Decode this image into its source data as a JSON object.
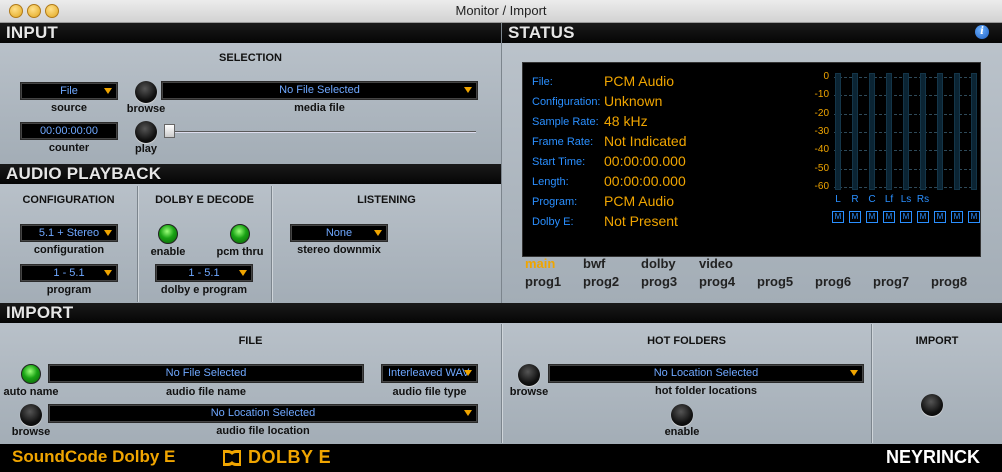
{
  "window": {
    "title": "Monitor / Import"
  },
  "input": {
    "header": "INPUT",
    "selection_label": "SELECTION",
    "source": {
      "value": "File",
      "label": "source"
    },
    "browse_label": "browse",
    "media_file": {
      "value": "No File Selected",
      "label": "media file"
    },
    "counter": {
      "value": "00:00:00:00",
      "label": "counter"
    },
    "play_label": "play"
  },
  "playback": {
    "header": "AUDIO PLAYBACK",
    "configuration_title": "CONFIGURATION",
    "configuration": {
      "value": "5.1 + Stereo",
      "label": "configuration"
    },
    "program": {
      "value": "1 - 5.1",
      "label": "program"
    },
    "decode_title": "DOLBY E DECODE",
    "enable_label": "enable",
    "pcm_thru_label": "pcm thru",
    "dolby_program": {
      "value": "1 - 5.1",
      "label": "dolby e program"
    },
    "listening_title": "LISTENING",
    "stereo_downmix": {
      "value": "None",
      "label": "stereo downmix"
    }
  },
  "status": {
    "header": "STATUS",
    "info_glyph": "i",
    "rows": [
      {
        "label": "File:",
        "value": "PCM Audio"
      },
      {
        "label": "Configuration:",
        "value": "Unknown"
      },
      {
        "label": "Sample Rate:",
        "value": "48 kHz"
      },
      {
        "label": "Frame Rate:",
        "value": "Not Indicated"
      },
      {
        "label": "Start Time:",
        "value": "00:00:00.000"
      },
      {
        "label": "Length:",
        "value": "00:00:00.000"
      },
      {
        "label": "Program:",
        "value": "PCM Audio"
      },
      {
        "label": "Dolby E:",
        "value": "Not Present"
      }
    ],
    "db_scale": [
      "0",
      "-10",
      "-20",
      "-30",
      "-40",
      "-50",
      "-60"
    ],
    "channels": [
      "L",
      "R",
      "C",
      "Lf",
      "Ls",
      "Rs",
      "",
      "",
      ""
    ],
    "mute_label": "M",
    "tabs_row1": [
      "main",
      "bwf",
      "dolby",
      "video"
    ],
    "tabs_row2": [
      "prog1",
      "prog2",
      "prog3",
      "prog4",
      "prog5",
      "prog6",
      "prog7",
      "prog8"
    ],
    "active_tab": "main"
  },
  "import": {
    "header": "IMPORT",
    "file_title": "FILE",
    "auto_name_label": "auto name",
    "audio_file_name": {
      "value": "No File Selected",
      "label": "audio file name"
    },
    "audio_file_type": {
      "value": "Interleaved WAV",
      "label": "audio file type"
    },
    "browse_label": "browse",
    "audio_file_location": {
      "value": "No Location Selected",
      "label": "audio file location"
    },
    "hot_folders_title": "HOT FOLDERS",
    "hot_browse_label": "browse",
    "hot_folder_locations": {
      "value": "No Location Selected",
      "label": "hot folder locations"
    },
    "hot_enable_label": "enable",
    "import_title": "IMPORT"
  },
  "footer": {
    "product": "SoundCode Dolby E",
    "dolby_logo": "DOLBY E",
    "brand": "NEYRINCK"
  },
  "colors": {
    "accent": "#f0a500",
    "display_blue": "#2a8fff",
    "led_green": "#19a314"
  }
}
